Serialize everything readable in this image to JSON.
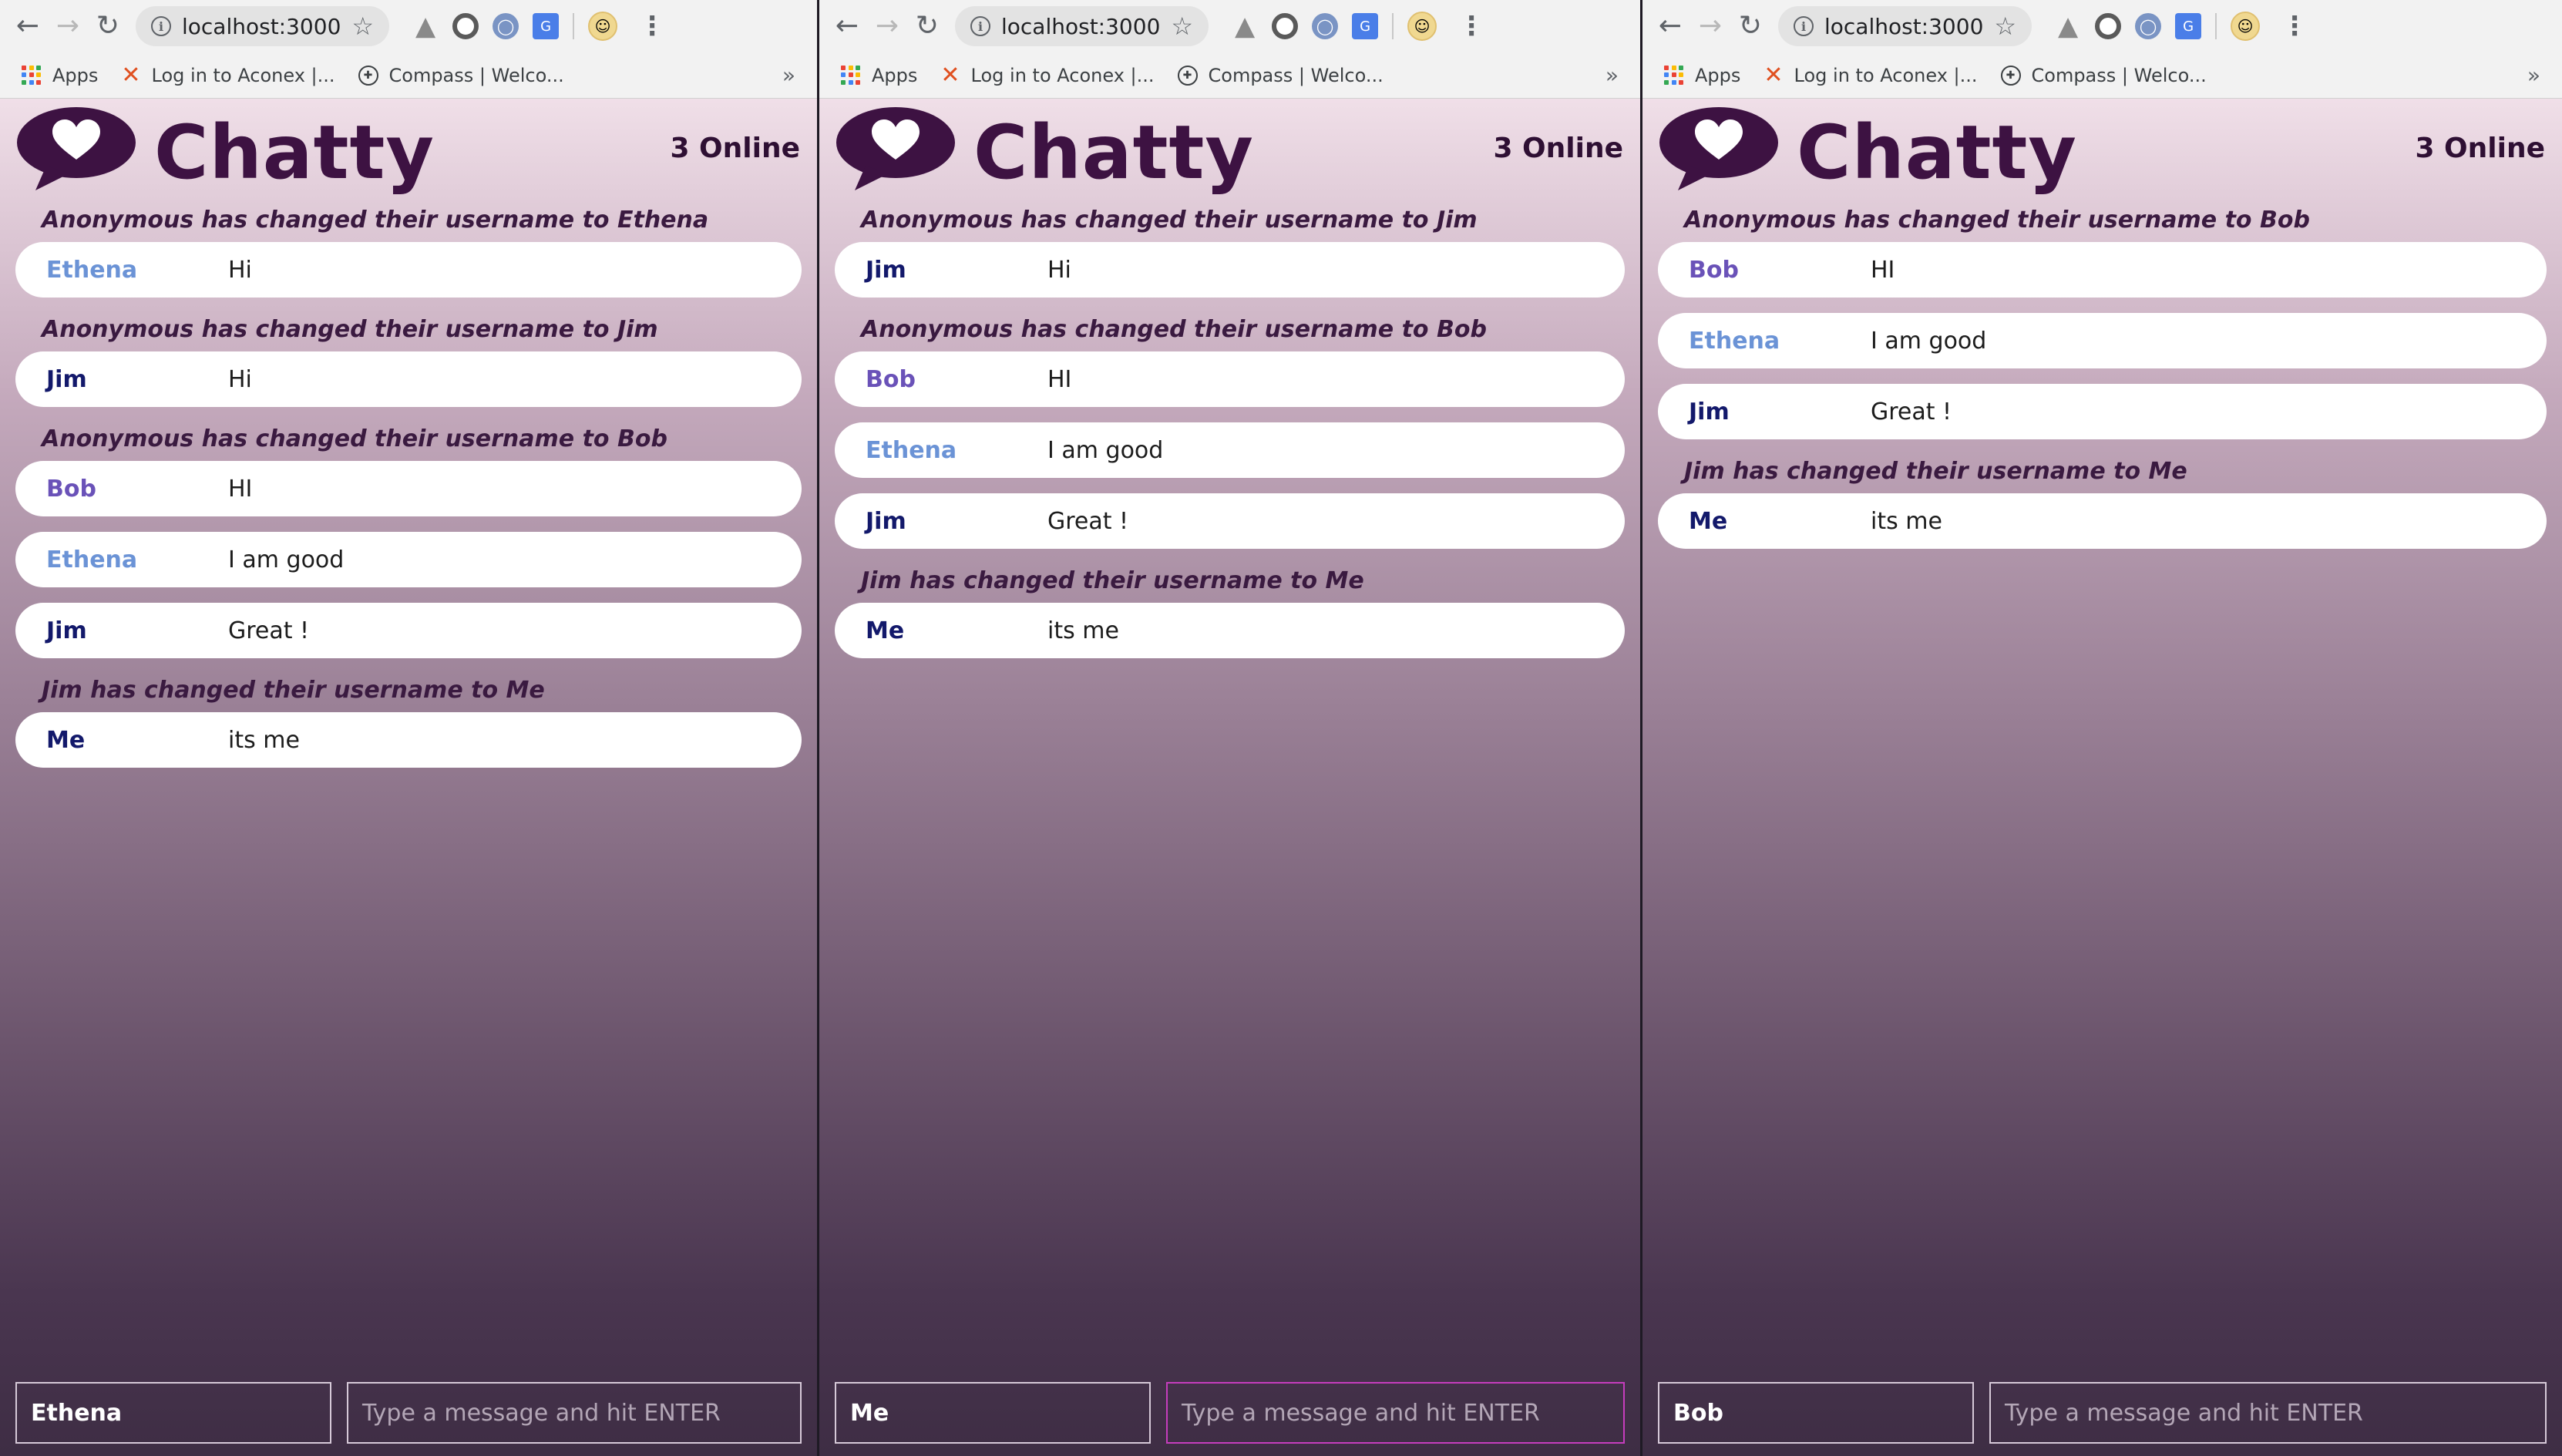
{
  "colors": {
    "brand": "#3d1242",
    "user_ethena": "#6b93d6",
    "user_jim": "#13196b",
    "user_bob": "#6a52b8",
    "user_me": "#13196b",
    "focus_border": "#c53dbd"
  },
  "browser": {
    "url": "localhost:3000",
    "bookmarks": [
      "Apps",
      "Log in to Aconex |...",
      "Compass | Welco..."
    ],
    "overflow": "»"
  },
  "app": {
    "brand": "Chatty",
    "online": "3 Online",
    "placeholder": "Type a message and hit ENTER"
  },
  "windows": [
    {
      "username": "Ethena",
      "focused_message_input": false,
      "messages": [
        {
          "type": "system",
          "text": "Anonymous has changed their username to Ethena"
        },
        {
          "type": "chat",
          "user": "Ethena",
          "content": "Hi"
        },
        {
          "type": "system",
          "text": "Anonymous has changed their username to Jim"
        },
        {
          "type": "chat",
          "user": "Jim",
          "content": "Hi"
        },
        {
          "type": "system",
          "text": "Anonymous has changed their username to Bob"
        },
        {
          "type": "chat",
          "user": "Bob",
          "content": "HI"
        },
        {
          "type": "chat",
          "user": "Ethena",
          "content": "I am good"
        },
        {
          "type": "chat",
          "user": "Jim",
          "content": "Great !"
        },
        {
          "type": "system",
          "text": "Jim has changed their username to Me"
        },
        {
          "type": "chat",
          "user": "Me",
          "content": "its me"
        }
      ]
    },
    {
      "username": "Me",
      "focused_message_input": true,
      "messages": [
        {
          "type": "system",
          "text": "Anonymous has changed their username to Jim"
        },
        {
          "type": "chat",
          "user": "Jim",
          "content": "Hi"
        },
        {
          "type": "system",
          "text": "Anonymous has changed their username to Bob"
        },
        {
          "type": "chat",
          "user": "Bob",
          "content": "HI"
        },
        {
          "type": "chat",
          "user": "Ethena",
          "content": "I am good"
        },
        {
          "type": "chat",
          "user": "Jim",
          "content": "Great !"
        },
        {
          "type": "system",
          "text": "Jim has changed their username to Me"
        },
        {
          "type": "chat",
          "user": "Me",
          "content": "its me"
        }
      ]
    },
    {
      "username": "Bob",
      "focused_message_input": false,
      "messages": [
        {
          "type": "system",
          "text": "Anonymous has changed their username to Bob"
        },
        {
          "type": "chat",
          "user": "Bob",
          "content": "HI"
        },
        {
          "type": "chat",
          "user": "Ethena",
          "content": "I am good"
        },
        {
          "type": "chat",
          "user": "Jim",
          "content": "Great !"
        },
        {
          "type": "system",
          "text": "Jim has changed their username to Me"
        },
        {
          "type": "chat",
          "user": "Me",
          "content": "its me"
        }
      ]
    }
  ]
}
